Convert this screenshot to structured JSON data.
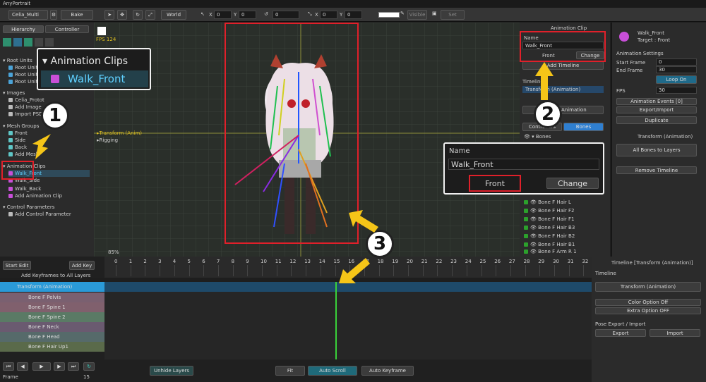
{
  "app": {
    "title": "AnyPortrait",
    "object_name": "Celia_Multi",
    "bake_label": "Bake",
    "world_label": "World",
    "visible_label": "Visible",
    "set_label": "Set",
    "x_label": "X",
    "y_label": "Y",
    "x_val": "0",
    "y_val": "0",
    "rot_val": "0",
    "sx_val": "0",
    "sy_val": "0"
  },
  "left": {
    "tab_hierarchy": "Hierarchy",
    "tab_controller": "Controller",
    "root_units_header": "Root Units",
    "root_units": [
      "Root Unit",
      "Root Unit",
      "Root Unit"
    ],
    "images_header": "Images",
    "images": [
      "Celia_Protot",
      "Add Image",
      "Import PSD"
    ],
    "mesh_groups_header": "Mesh Groups",
    "mesh_groups": [
      "Front",
      "Side",
      "Back",
      "Add Mesh"
    ],
    "anim_clips_header": "Animation Clips",
    "anim_clips": [
      "Walk_Front",
      "Walk_Side",
      "Walk_Back",
      "Add Animation Clip"
    ],
    "control_params_header": "Control Parameters",
    "add_control_param": "Add Control Parameter"
  },
  "viewport": {
    "fps": "FPS 124",
    "zoom": "85%",
    "overlay_items": [
      "Transform (Anim)",
      "Rigging"
    ]
  },
  "callout1": {
    "header": "Animation Clips",
    "item": "Walk_Front",
    "number": "1"
  },
  "callout2": {
    "name_label": "Name",
    "name_value": "Walk_Front",
    "front_label": "Front",
    "change_label": "Change",
    "number": "2"
  },
  "callout3": {
    "number": "3"
  },
  "mid": {
    "title": "Animation Clip",
    "name_label": "Name",
    "name_value": "Walk_Front",
    "front_label": "Front",
    "change_label": "Change",
    "add_timeline": "Add Timeline",
    "timeline_label": "Timeline",
    "timeline_item": "Transform (Animation)",
    "remove_animation": "Remove Animation",
    "tab_controllers": "Controllers",
    "tab_bones": "Bones",
    "bones_header": "Bones",
    "bones": [
      "Bone F Hair L",
      "Bone F Hair F2",
      "Bone F Hair F1",
      "Bone F Hair B3",
      "Bone F Hair B2",
      "Bone F Hair B1",
      "Bone F Arm R 1",
      "Bone F Arm R 2"
    ]
  },
  "right": {
    "clip_name": "Walk_Front",
    "target": "Target : Front",
    "anim_settings": "Animation Settings",
    "start_frame_label": "Start Frame",
    "start_frame": "0",
    "end_frame_label": "End Frame",
    "end_frame": "30",
    "loop_on": "Loop On",
    "fps_label": "FPS",
    "fps": "30",
    "anim_events": "Animation Events [0]",
    "export_import": "Export/Import",
    "duplicate": "Duplicate",
    "transform_anim": "Transform (Animation)",
    "all_bones": "All Bones to Layers",
    "remove_timeline": "Remove Timeline",
    "timeline_header": "Timeline [Transform (Animation)]",
    "timeline_label": "Timeline",
    "timeline_value": "Transform (Animation)",
    "color_option": "Color Option Off",
    "extra_option": "Extra Option OFF",
    "pose_export": "Pose Export / Import",
    "export": "Export",
    "import": "Import"
  },
  "timeline": {
    "start_edit": "Start Edit",
    "add_key": "Add Key",
    "add_keyframes_all": "Add Keyframes to All Layers",
    "layer_main": "Transform (Animation)",
    "layers": [
      "Bone F Pelvis",
      "Bone F Spine 1",
      "Bone F Spine 2",
      "Bone F Neck",
      "Bone F Head",
      "Bone F Hair Up1"
    ],
    "ticks": [
      "0",
      "1",
      "2",
      "3",
      "4",
      "5",
      "6",
      "7",
      "8",
      "9",
      "10",
      "11",
      "12",
      "13",
      "14",
      "15",
      "16",
      "17",
      "18",
      "19",
      "20",
      "21",
      "22",
      "23",
      "24",
      "25",
      "26",
      "27",
      "28",
      "29",
      "30",
      "31",
      "32"
    ],
    "frame_label": "Frame",
    "frame_value": "15",
    "unhide_layers": "Unhide Layers",
    "fit": "Fit",
    "auto_scroll": "Auto Scroll",
    "auto_keyframe": "Auto Keyframe"
  },
  "colors": {
    "accent_blue": "#2f7fd0",
    "highlight": "#e0202a",
    "yellow_arrow": "#f5c518",
    "green_playhead": "#3ad13a"
  }
}
